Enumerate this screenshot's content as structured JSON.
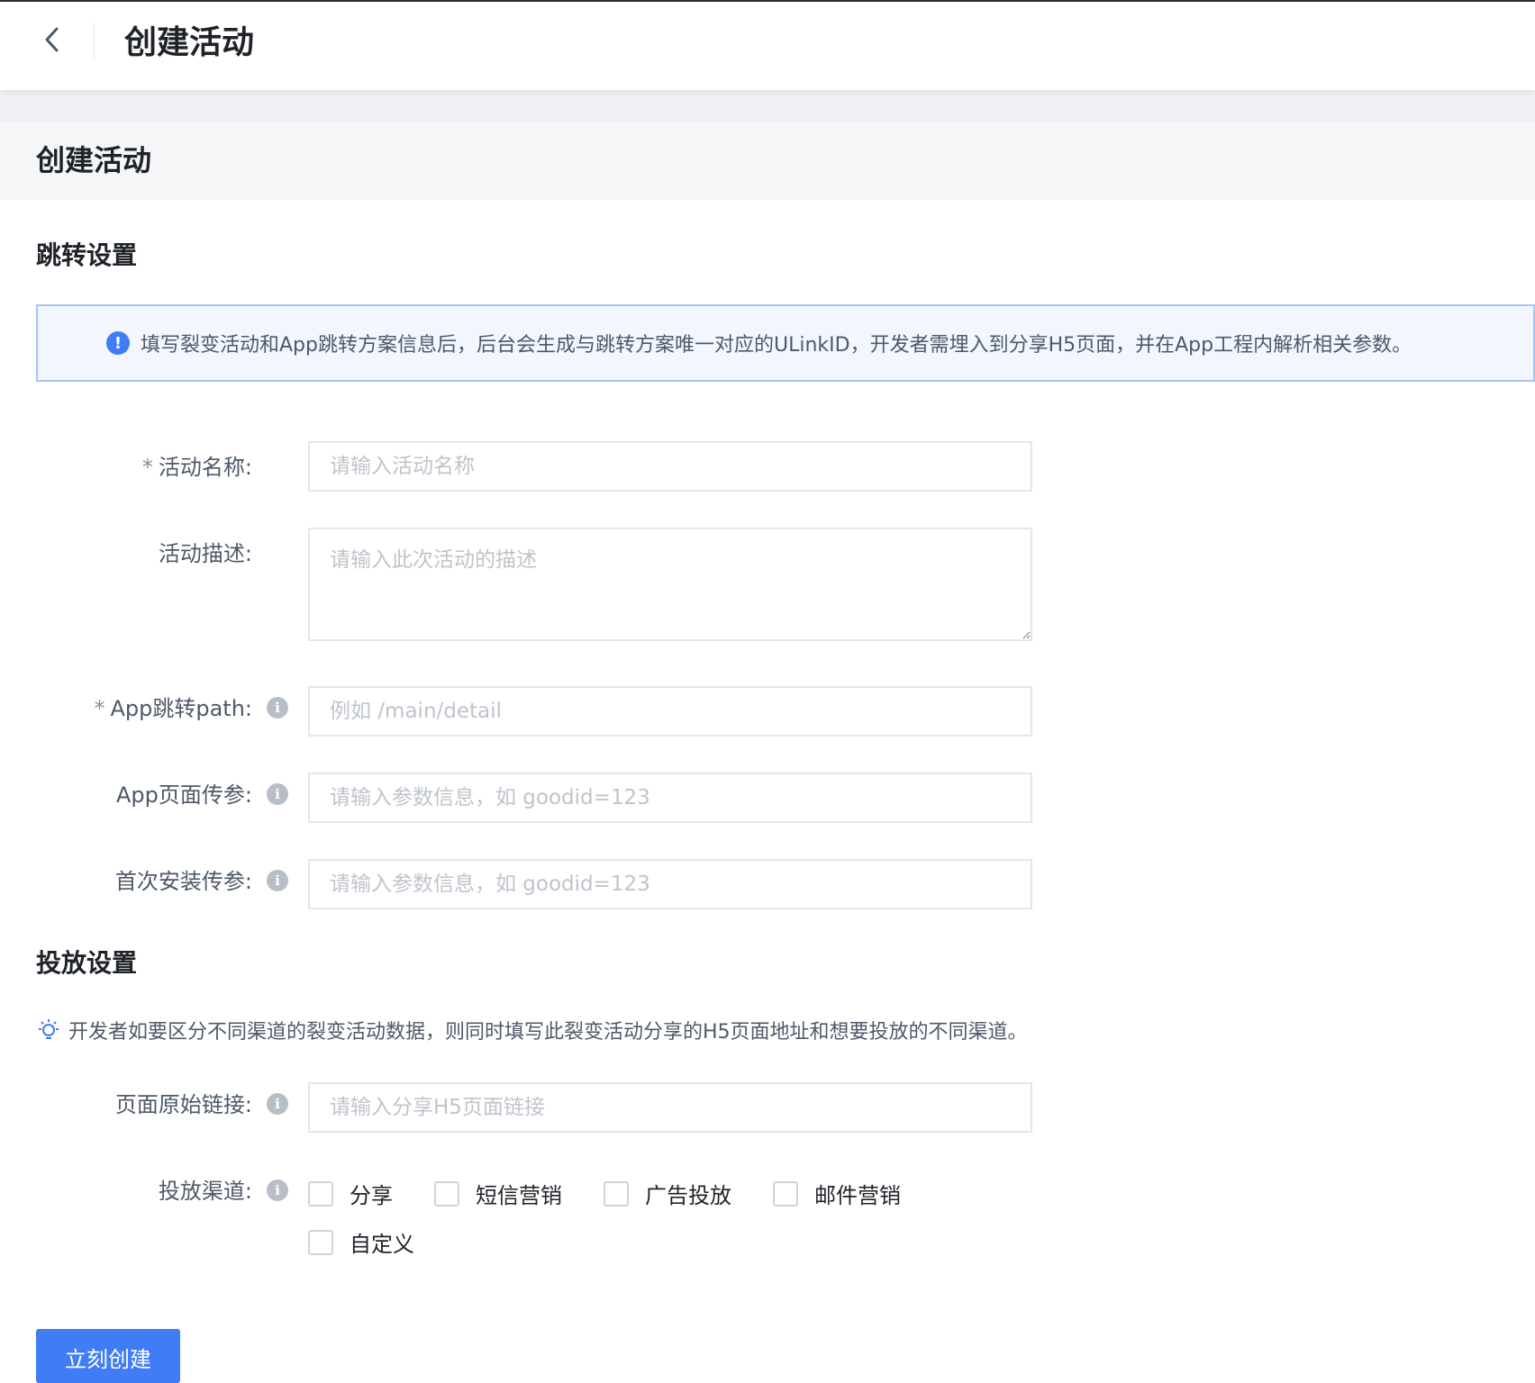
{
  "header": {
    "title": "创建活动",
    "back_icon": "chevron-left-icon"
  },
  "page": {
    "title": "创建活动"
  },
  "jump_section": {
    "title": "跳转设置",
    "alert_icon": "exclamation-circle-icon",
    "alert_text": "填写裂变活动和App跳转方案信息后，后台会生成与跳转方案唯一对应的ULinkID，开发者需埋入到分享H5页面，并在App工程内解析相关参数。",
    "fields": {
      "name": {
        "label": "活动名称:",
        "required": "*",
        "value": "",
        "placeholder": "请输入活动名称"
      },
      "desc": {
        "label": "活动描述:",
        "value": "",
        "placeholder": "请输入此次活动的描述"
      },
      "path": {
        "label": "App跳转path:",
        "required": "*",
        "value": "",
        "placeholder": "例如 /main/detail"
      },
      "page_params": {
        "label": "App页面传参:",
        "value": "",
        "placeholder": "请输入参数信息，如 goodid=123"
      },
      "install_params": {
        "label": "首次安装传参:",
        "value": "",
        "placeholder": "请输入参数信息，如 goodid=123"
      }
    }
  },
  "delivery_section": {
    "title": "投放设置",
    "tip_icon": "lightbulb-icon",
    "tip_text": "开发者如要区分不同渠道的裂变活动数据，则同时填写此裂变活动分享的H5页面地址和想要投放的不同渠道。",
    "fields": {
      "link": {
        "label": "页面原始链接:",
        "value": "",
        "placeholder": "请输入分享H5页面链接"
      },
      "channels": {
        "label": "投放渠道:",
        "options": [
          {
            "label": "分享",
            "checked": false
          },
          {
            "label": "短信营销",
            "checked": false
          },
          {
            "label": "广告投放",
            "checked": false
          },
          {
            "label": "邮件营销",
            "checked": false
          },
          {
            "label": "自定义",
            "checked": false
          }
        ]
      }
    }
  },
  "submit": {
    "label": "立刻创建"
  },
  "colors": {
    "primary": "#3f7cf5",
    "alert_bg": "#f2f6ff",
    "alert_border": "#a9c4f5",
    "page_head_bg": "#f5f6f8"
  }
}
